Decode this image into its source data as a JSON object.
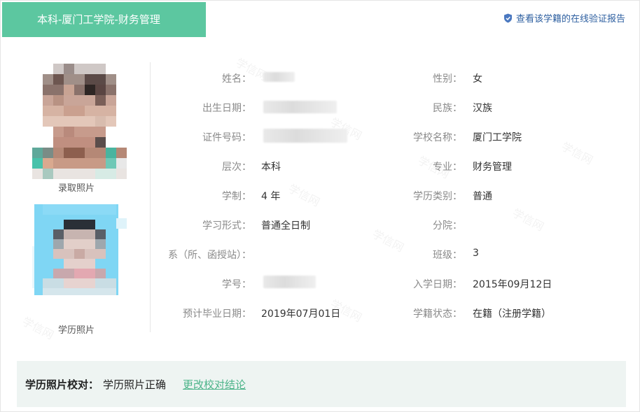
{
  "header": {
    "tab_title": "本科-厦门工学院-财务管理",
    "verify_link": "查看该学籍的在线验证报告"
  },
  "watermark_text": "学信网",
  "photos": {
    "admission_caption": "录取照片",
    "diploma_caption": "学历照片"
  },
  "fields_left": [
    {
      "label": "姓名：",
      "value": ""
    },
    {
      "label": "出生日期：",
      "value": ""
    },
    {
      "label": "证件号码：",
      "value": ""
    },
    {
      "label": "层次：",
      "value": "本科"
    },
    {
      "label": "学制：",
      "value": "4 年"
    },
    {
      "label": "学习形式：",
      "value": "普通全日制"
    },
    {
      "label": "系（所、函授站）：",
      "value": ""
    },
    {
      "label": "学号：",
      "value": ""
    },
    {
      "label": "预计毕业日期：",
      "value": "2019年07月01日"
    }
  ],
  "fields_right": [
    {
      "label": "性别：",
      "value": "女"
    },
    {
      "label": "民族：",
      "value": "汉族"
    },
    {
      "label": "学校名称：",
      "value": "厦门工学院"
    },
    {
      "label": "专业：",
      "value": "财务管理"
    },
    {
      "label": "学历类别：",
      "value": "普通"
    },
    {
      "label": "分院：",
      "value": ""
    },
    {
      "label": "班级：",
      "value": "3"
    },
    {
      "label": "入学日期：",
      "value": "2015年09月12日"
    },
    {
      "label": "学籍状态：",
      "value": "在籍（注册学籍）"
    }
  ],
  "photo_check": {
    "label": "学历照片校对：",
    "result": "学历照片正确",
    "change_link": "更改校对结论"
  },
  "colors": {
    "brand_green": "#5cc7a0",
    "link_blue": "#2d5fa0",
    "link_green": "#4db48a",
    "check_bg": "#eef4f2"
  }
}
